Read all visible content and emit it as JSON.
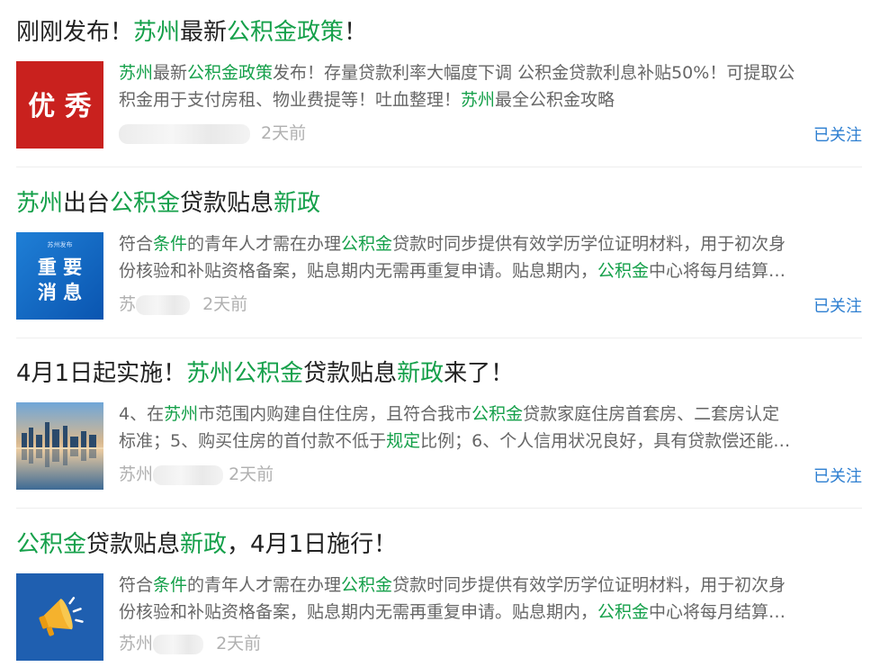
{
  "accent_color": "#15a04a",
  "link_color": "#2e7fd1",
  "items": [
    {
      "title": [
        "刚刚发布！",
        "苏州",
        "最新",
        "公积金政策",
        "！"
      ],
      "summary_line1": [
        "苏州",
        "最新",
        "公积金政策",
        "发布！存量贷款利率大幅度下调 公积金贷款利息补贴50%！可提取公"
      ],
      "summary_line2": [
        "积金用于支付房租、物业费提等！吐血整理！",
        "苏州",
        "最全公积金攻略"
      ],
      "source_prefix": "",
      "time": "2天前",
      "follow_label": "已关注",
      "thumb_text": "优 秀"
    },
    {
      "title": [
        "苏州",
        "出台",
        "公积金",
        "贷款贴息",
        "新政"
      ],
      "summary_line1": [
        "符合",
        "条件",
        "的青年人才需在办理",
        "公积金",
        "贷款时同步提供有效学历学位证明材料，用于初次身"
      ],
      "summary_line2": [
        "份核验和补贴资格备案，贴息期内无需再重复申请。贴息期内，",
        "公积金",
        "中心将每月结算…"
      ],
      "source_prefix": "苏",
      "time": "2天前",
      "follow_label": "已关注",
      "thumb_small": "苏州发布",
      "thumb_line1": "重 要",
      "thumb_line2": "消 息"
    },
    {
      "title": [
        "4月1日起实施！",
        "苏州公积金",
        "贷款贴息",
        "新政",
        "来了！"
      ],
      "summary_line1": [
        "4、在",
        "苏州",
        "市范围内购建自住住房，且符合我市",
        "公积金",
        "贷款家庭住房首套房、二套房认定"
      ],
      "summary_line2": [
        "标准；5、购买住房的首付款不低于",
        "规定",
        "比例；6、个人信用状况良好，具有贷款偿还能…"
      ],
      "source_prefix": "苏州",
      "time": "2天前",
      "follow_label": "已关注"
    },
    {
      "title": [
        "公积金",
        "贷款贴息",
        "新政",
        "，4月1日施行！"
      ],
      "summary_line1": [
        "符合",
        "条件",
        "的青年人才需在办理",
        "公积金",
        "贷款时同步提供有效学历学位证明材料，用于初次身"
      ],
      "summary_line2": [
        "份核验和补贴资格备案，贴息期内无需再重复申请。贴息期内，",
        "公积金",
        "中心将每月结算…"
      ],
      "source_prefix": "苏州",
      "time": "2天前"
    }
  ]
}
